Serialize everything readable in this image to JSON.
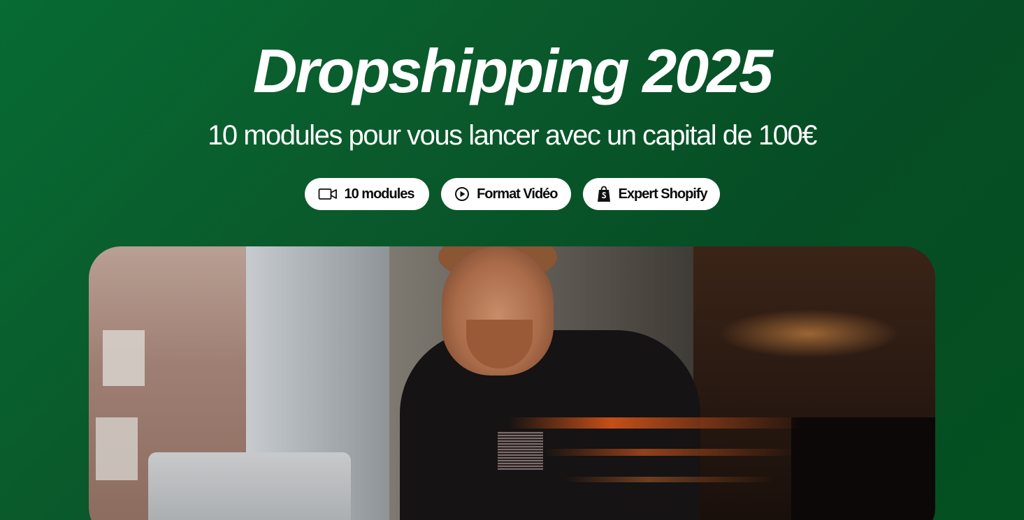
{
  "hero": {
    "title": "Dropshipping 2025",
    "subtitle": "10 modules pour vous lancer avec un capital de 100€"
  },
  "badges": [
    {
      "label": "10 modules",
      "icon": "video-camera-icon"
    },
    {
      "label": "Format Vidéo",
      "icon": "play-circle-icon"
    },
    {
      "label": "Expert Shopify",
      "icon": "shopify-bag-icon"
    }
  ],
  "photo": {
    "subject": "man-working-on-laptop"
  },
  "colors": {
    "background": "#0a5a2c",
    "badge_background": "#ffffff",
    "badge_text": "#0b0b0b",
    "title_text": "#ffffff"
  }
}
